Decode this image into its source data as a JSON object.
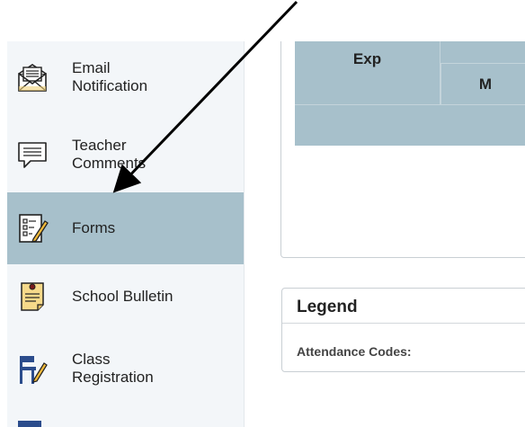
{
  "sidebar": {
    "items": [
      {
        "label": "Email\nNotification",
        "icon": "email-envelope-icon"
      },
      {
        "label": "Teacher\nComments",
        "icon": "comment-bubble-icon"
      },
      {
        "label": "Forms",
        "icon": "forms-checklist-pencil-icon",
        "active": true
      },
      {
        "label": "School Bulletin",
        "icon": "bulletin-note-icon"
      },
      {
        "label": "Class\nRegistration",
        "icon": "desk-chair-pencil-icon"
      }
    ]
  },
  "table": {
    "headers": {
      "exp": "Exp",
      "m": "M"
    }
  },
  "legend": {
    "title": "Legend",
    "attendance_codes_label": "Attendance Codes:"
  },
  "colors": {
    "active_bg": "#a7c0cb",
    "sidebar_bg": "#f3f6f9",
    "table_header_bg": "#a7c0cb"
  }
}
